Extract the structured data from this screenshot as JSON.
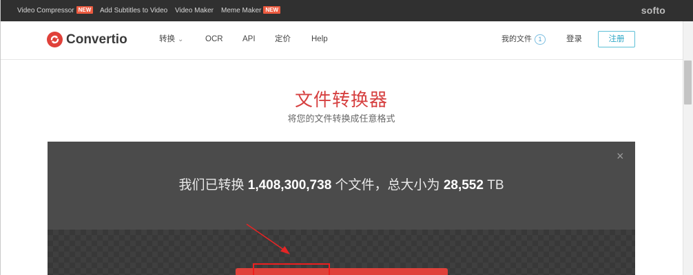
{
  "topbar": {
    "items": [
      {
        "label": "Video Compressor",
        "badge": "NEW"
      },
      {
        "label": "Add Subtitles to Video",
        "badge": ""
      },
      {
        "label": "Video Maker",
        "badge": ""
      },
      {
        "label": "Meme Maker",
        "badge": "NEW"
      }
    ],
    "brand": "softo"
  },
  "header": {
    "logo_text": "Convertio",
    "nav": [
      {
        "label": "转换",
        "has_dropdown": true
      },
      {
        "label": "OCR"
      },
      {
        "label": "API"
      },
      {
        "label": "定价"
      },
      {
        "label": "Help"
      }
    ],
    "my_files_label": "我的文件",
    "my_files_count": "1",
    "login_label": "登录",
    "signup_label": "注册"
  },
  "hero": {
    "title": "文件转换器",
    "subtitle": "将您的文件转换成任意格式"
  },
  "converter": {
    "stats_prefix": "我们已转换 ",
    "files_count": "1,408,300,738",
    "stats_middle": " 个文件，总大小为 ",
    "total_size": "28,552",
    "stats_unit": " TB",
    "close_symbol": "×"
  },
  "colors": {
    "accent": "#e0413a",
    "topbar_bg": "#303030",
    "converter_bg": "#4b4b4b",
    "signup_border": "#5bbfd6",
    "annotation_red": "#ee1f1f"
  },
  "icons": [
    "convertio-logo-icon",
    "chevron-down-icon",
    "close-icon",
    "annotation-arrow"
  ]
}
